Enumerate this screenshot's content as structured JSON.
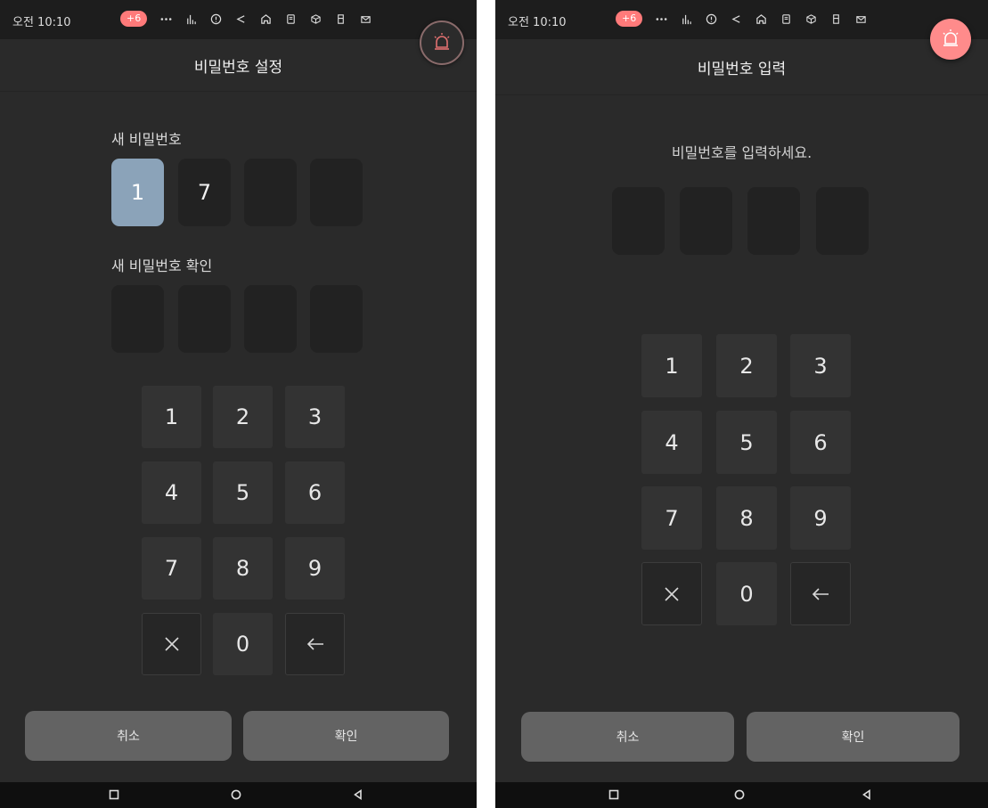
{
  "status": {
    "time": "오전 10:10",
    "badge": "+6",
    "icons": [
      "more-dots-icon",
      "bar-chart-icon",
      "alert-circle-icon",
      "share-icon",
      "home-icon",
      "document-icon",
      "cube-icon",
      "bookmark-icon",
      "mail-icon"
    ]
  },
  "setup": {
    "title": "비밀번호 설정",
    "new_label": "새 비밀번호",
    "confirm_label": "새 비밀번호 확인",
    "new_pin": [
      "1",
      "7",
      "",
      ""
    ],
    "confirm_pin": [
      "",
      "",
      "",
      ""
    ],
    "keys": [
      "1",
      "2",
      "3",
      "4",
      "5",
      "6",
      "7",
      "8",
      "9",
      "",
      "0",
      ""
    ],
    "cancel": "취소",
    "ok": "확인"
  },
  "entry": {
    "title": "비밀번호 입력",
    "prompt": "비밀번호를 입력하세요.",
    "pin": [
      "",
      "",
      "",
      ""
    ],
    "keys": [
      "1",
      "2",
      "3",
      "4",
      "5",
      "6",
      "7",
      "8",
      "9",
      "",
      "0",
      ""
    ],
    "cancel": "취소",
    "ok": "확인"
  },
  "colors": {
    "background": "#2a2a2a",
    "active_pin": "#8ba3b9",
    "badge": "#ff7a7a",
    "alarm": "#ff8b8b"
  }
}
